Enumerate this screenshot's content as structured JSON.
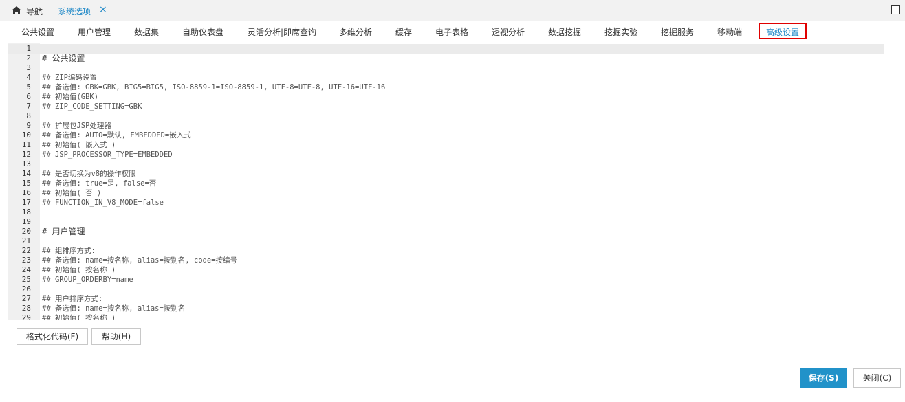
{
  "topbar": {
    "nav_label": "导航",
    "active_crumb": "系统选项",
    "close_glyph": "×"
  },
  "tabs": [
    {
      "label": "公共设置"
    },
    {
      "label": "用户管理"
    },
    {
      "label": "数据集"
    },
    {
      "label": "自助仪表盘"
    },
    {
      "label": "灵活分析|即席查询"
    },
    {
      "label": "多维分析"
    },
    {
      "label": "缓存"
    },
    {
      "label": "电子表格"
    },
    {
      "label": "透视分析"
    },
    {
      "label": "数据挖掘"
    },
    {
      "label": "挖掘实验"
    },
    {
      "label": "挖掘服务"
    },
    {
      "label": "移动端"
    },
    {
      "label": "高级设置",
      "active": true
    }
  ],
  "editor": {
    "lines": [
      {
        "n": "1",
        "text": ""
      },
      {
        "n": "2",
        "text": "# 公共设置"
      },
      {
        "n": "3",
        "text": ""
      },
      {
        "n": "4",
        "text": "## ZIP编码设置"
      },
      {
        "n": "5",
        "text": "## 备选值: GBK=GBK, BIG5=BIG5, ISO-8859-1=ISO-8859-1, UTF-8=UTF-8, UTF-16=UTF-16"
      },
      {
        "n": "6",
        "text": "## 初始值(GBK)"
      },
      {
        "n": "7",
        "text": "## ZIP_CODE_SETTING=GBK"
      },
      {
        "n": "8",
        "text": ""
      },
      {
        "n": "9",
        "text": "## 扩展包JSP处理器"
      },
      {
        "n": "10",
        "text": "## 备选值: AUTO=默认, EMBEDDED=嵌入式"
      },
      {
        "n": "11",
        "text": "## 初始值( 嵌入式 )"
      },
      {
        "n": "12",
        "text": "## JSP_PROCESSOR_TYPE=EMBEDDED"
      },
      {
        "n": "13",
        "text": ""
      },
      {
        "n": "14",
        "text": "## 是否切换为v8的操作权限"
      },
      {
        "n": "15",
        "text": "## 备选值: true=是, false=否"
      },
      {
        "n": "16",
        "text": "## 初始值( 否 )"
      },
      {
        "n": "17",
        "text": "## FUNCTION_IN_V8_MODE=false"
      },
      {
        "n": "18",
        "text": ""
      },
      {
        "n": "19",
        "text": ""
      },
      {
        "n": "20",
        "text": "# 用户管理"
      },
      {
        "n": "21",
        "text": ""
      },
      {
        "n": "22",
        "text": "## 组排序方式:"
      },
      {
        "n": "23",
        "text": "## 备选值: name=按名称, alias=按别名, code=按编号"
      },
      {
        "n": "24",
        "text": "## 初始值( 按名称 )"
      },
      {
        "n": "25",
        "text": "## GROUP_ORDERBY=name"
      },
      {
        "n": "26",
        "text": ""
      },
      {
        "n": "27",
        "text": "## 用户排序方式:"
      },
      {
        "n": "28",
        "text": "## 备选值: name=按名称, alias=按别名"
      },
      {
        "n": "29",
        "text": "## 初始值( 按名称 )"
      }
    ]
  },
  "buttons": {
    "format": "格式化代码(F)",
    "help": "帮助(H)",
    "save": "保存(S)",
    "close": "关闭(C)"
  },
  "colors": {
    "accent": "#2192c9",
    "active_tab_text": "#1e88c7",
    "active_tab_border": "#e00000"
  }
}
